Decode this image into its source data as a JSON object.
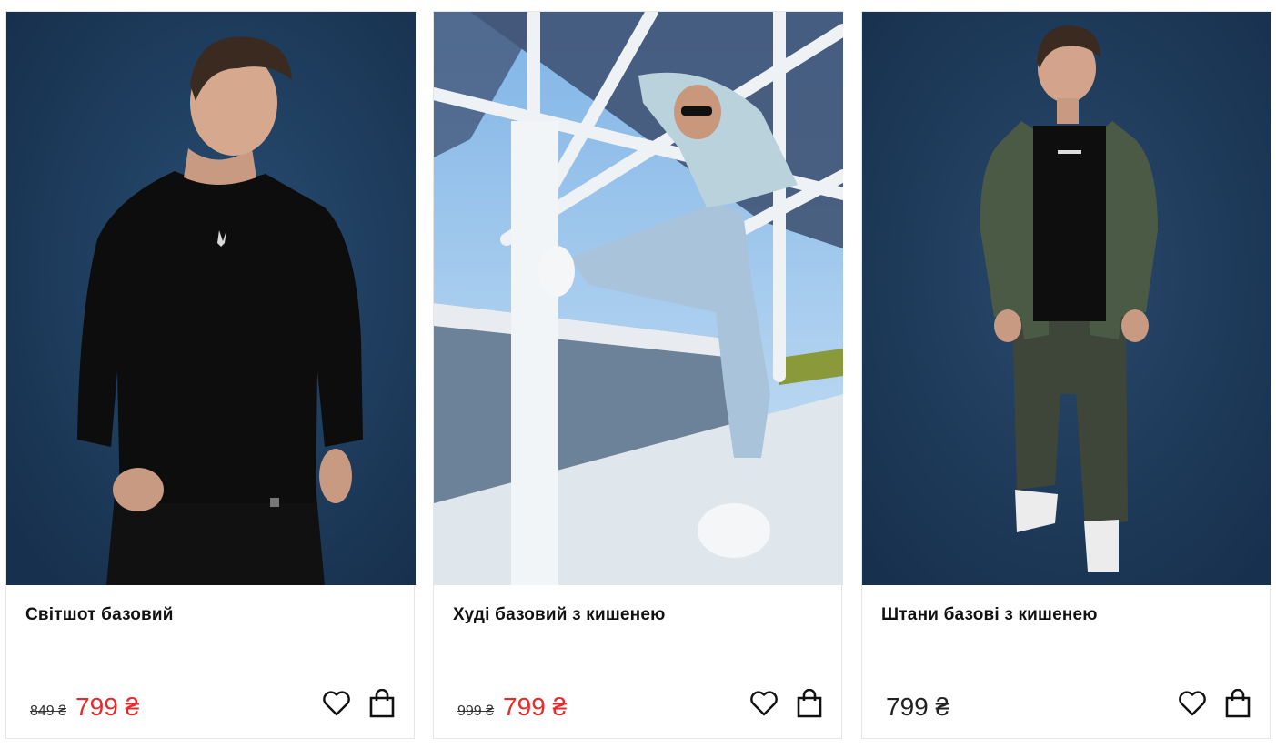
{
  "products": [
    {
      "title": "Світшот базовий",
      "old_price": "849 ₴",
      "price": "799 ₴",
      "on_sale": true,
      "photo_alt": "black-sweatshirt-model-photo"
    },
    {
      "title": "Худі базовий з кишенею",
      "old_price": "999 ₴",
      "price": "799 ₴",
      "on_sale": true,
      "photo_alt": "light-blue-hoodie-model-photo"
    },
    {
      "title": "Штани базові з кишенею",
      "old_price": "",
      "price": "799 ₴",
      "on_sale": false,
      "photo_alt": "khaki-pants-model-photo"
    }
  ],
  "icons": {
    "favorite": "heart-icon",
    "cart": "shopping-bag-icon"
  },
  "colors": {
    "sale_price": "#e52b2b",
    "regular_price": "#222222",
    "photo_backdrop": "#1e3a5c"
  }
}
